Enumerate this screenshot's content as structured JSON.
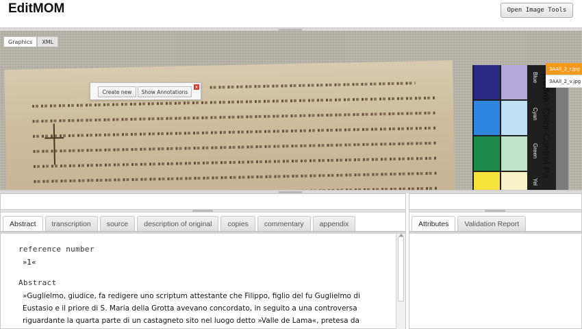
{
  "app": {
    "title": "EditMOM"
  },
  "header": {
    "tools_label": "Open Image Tools"
  },
  "viewer": {
    "tabs": [
      "Graphics",
      "XML"
    ],
    "active_tab": 0,
    "annotation_popup": {
      "create_label": "Create new",
      "show_label": "Show Annotations",
      "close_label": "x"
    },
    "image_list": [
      "3AAll_2_r.jpg",
      "3AAll_2_v.jpg"
    ],
    "colorchart": {
      "brand": "Kodak",
      "title": "Color Control Pa",
      "labels": [
        "Blue",
        "Cyan",
        "Green",
        "Yel"
      ]
    }
  },
  "editor": {
    "tabs": [
      "Abstract",
      "transcription",
      "source",
      "description of original",
      "copies",
      "commentary",
      "appendix"
    ],
    "active_tab": 0,
    "fields": {
      "ref_label": "reference number",
      "ref_value": "»1«",
      "abstract_label": "Abstract",
      "abstract_lines": [
        "»Guglielmo, giudice, fa redigere uno scriptum attestante che Filippo, figlio del fu Guglielmo di",
        "Eustasio e il priore di S. Maria della Grotta avevano concordato, in seguito a una controversa",
        "riguardante la quarta parte di un castagneto sito nel luogo detto »Valle de Lama«, pretesa da"
      ]
    }
  },
  "side_panel": {
    "tabs": [
      "Attributes",
      "Validation Report"
    ],
    "active_tab": 0
  },
  "colors": {
    "accent": "#f39a1c",
    "close": "#d63b2f"
  }
}
